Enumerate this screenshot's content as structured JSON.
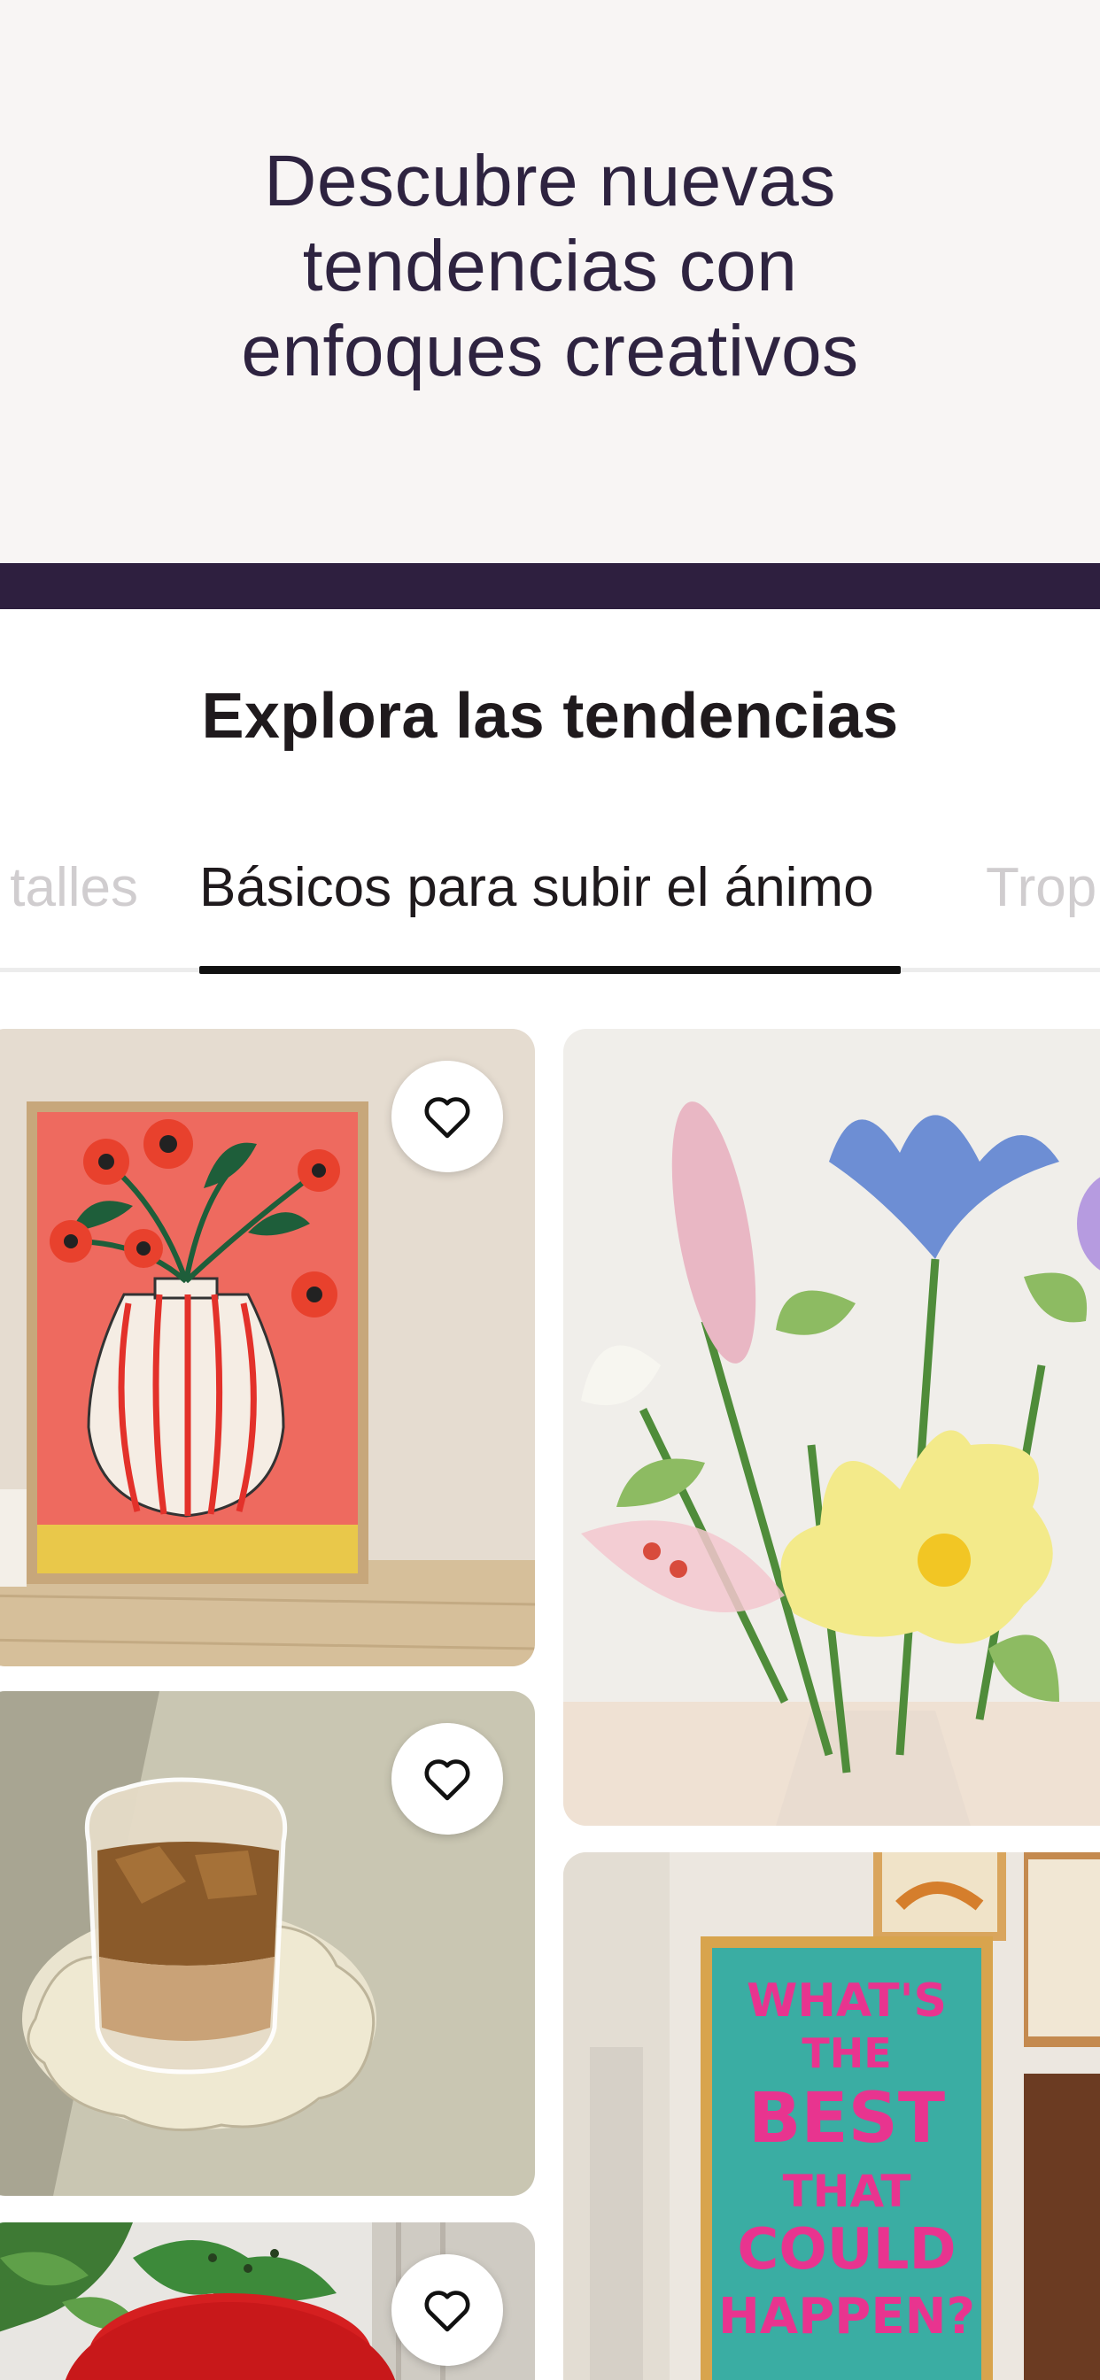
{
  "hero": {
    "line1": "Descubre nuevas",
    "line2": "tendencias con",
    "line3": "enfoques creativos"
  },
  "section": {
    "title": "Explora las tendencias"
  },
  "tabs": [
    {
      "label": "talles",
      "state": "partial-left"
    },
    {
      "label": "Básicos para subir el ánimo",
      "state": "active"
    },
    {
      "label": "Trop",
      "state": "partial-right"
    }
  ],
  "products": [
    {
      "image": "painting of red-striped vase with poppies",
      "favorite_icon": "heart-outline-icon"
    },
    {
      "image": "glass flower bouquet",
      "favorite_icon": "heart-outline-icon"
    },
    {
      "image": "wavy glass with iced coffee on scalloped coaster",
      "favorite_icon": "heart-outline-icon"
    },
    {
      "image": "teal poster with pink lettering",
      "poster_lines": [
        "WHAT'S",
        "THE",
        "BEST",
        "THAT",
        "COULD",
        "HAPPEN?"
      ]
    },
    {
      "image": "red strawberry-shaped dish on leaves",
      "favorite_icon": "heart-outline-icon"
    }
  ],
  "colors": {
    "hero_bg": "#f8f5f4",
    "hero_text": "#2e2340",
    "band": "#2e1f3f",
    "poster_bg": "#3aada3",
    "poster_text": "#e8348f"
  }
}
